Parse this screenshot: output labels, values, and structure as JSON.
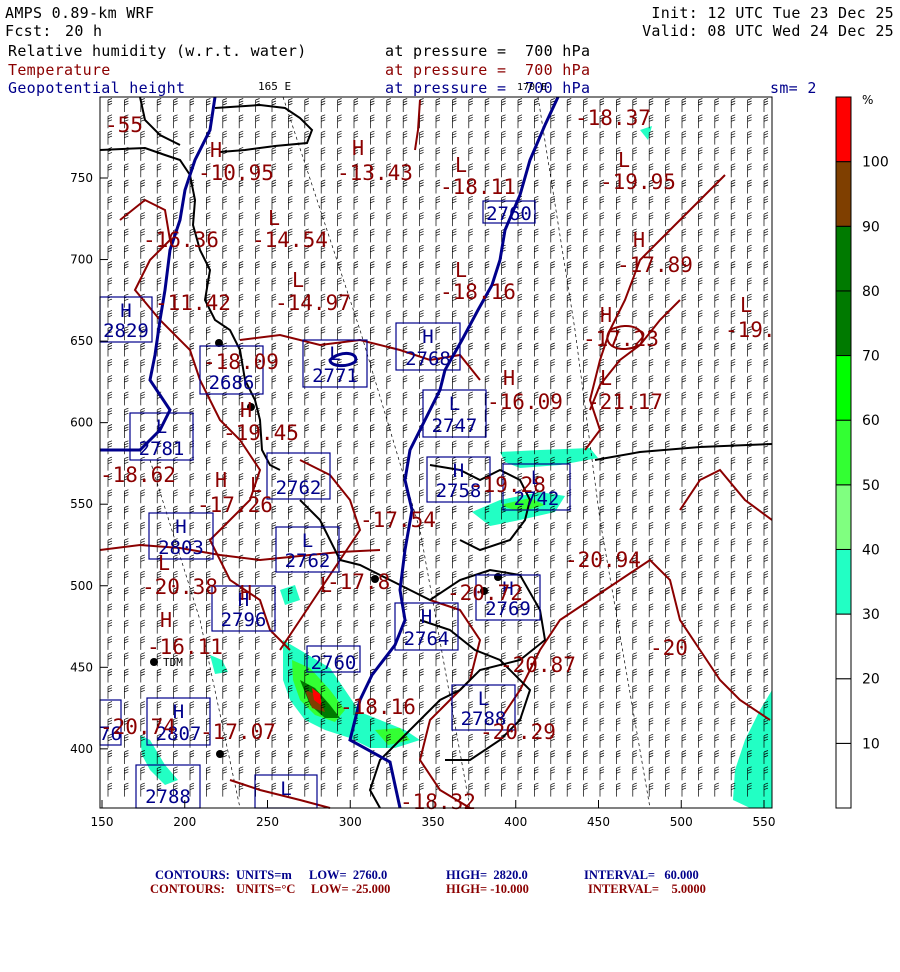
{
  "header": {
    "model": "AMPS 0.89-km WRF",
    "fcst_label": "Fcst:",
    "fcst_value": "20 h",
    "init": "Init: 12 UTC Tue 23 Dec 25",
    "valid": "Valid: 08 UTC Wed 24 Dec 25",
    "sm": "sm= 2"
  },
  "fields": [
    {
      "name": "Relative humidity (w.r.t. water)",
      "level": "at pressure =  700 hPa",
      "color": "#000000"
    },
    {
      "name": "Temperature",
      "level": "at pressure =  700 hPa",
      "color": "#8b0000"
    },
    {
      "name": "Geopotential height",
      "level": "at pressure =  700 hPa",
      "color": "#00008b"
    }
  ],
  "lon_labels": [
    "165 E",
    "170 E"
  ],
  "axes": {
    "x_ticks": [
      "150",
      "200",
      "250",
      "300",
      "350",
      "400",
      "450",
      "500",
      "550"
    ],
    "y_ticks": [
      "750",
      "700",
      "650",
      "600",
      "550",
      "500",
      "450",
      "400"
    ]
  },
  "colorbar": {
    "unit": "%",
    "levels": [
      "10",
      "20",
      "30",
      "40",
      "50",
      "60",
      "70",
      "80",
      "90",
      "100"
    ],
    "colors": [
      "#ffffff",
      "#ffffff",
      "#ffffff",
      "#22ffc4",
      "#80ff80",
      "#33ff33",
      "#00ff00",
      "#007a00",
      "#007a00",
      "#7f3f00",
      "#ff0000"
    ]
  },
  "temperature_labels": [
    "-18.37",
    "-10.95",
    "-13.43",
    "-18.11",
    "-19.95",
    "-14.54",
    "-16.36",
    "-17.89",
    "-18.16",
    "-14.97",
    "-11.42",
    "-17.23",
    "-19.",
    "-18.09",
    "-16.09",
    "-21.17",
    "-19.45",
    "-18.62",
    "-17.26",
    "-17.54",
    "-20.38",
    "-17.8",
    "-20.72",
    "-16.11",
    "-20.94",
    "-20.87",
    "-20",
    "-17.07",
    "-20.74",
    "-18.32",
    "-18.16",
    "-20.29",
    "-19.28",
    "-55"
  ],
  "hl_markers": [
    "H",
    "H",
    "L",
    "L",
    "L",
    "L",
    "H",
    "L",
    "L",
    "H",
    "H",
    "L",
    "H",
    "L",
    "H",
    "H",
    "L",
    "H",
    "L"
  ],
  "height_boxes": [
    {
      "hl": "",
      "value": "2760"
    },
    {
      "hl": "H",
      "value": "2829"
    },
    {
      "hl": "H",
      "value": "2768"
    },
    {
      "hl": "L",
      "value": "2771"
    },
    {
      "hl": "",
      "value": "2686"
    },
    {
      "hl": "L",
      "value": "2747"
    },
    {
      "hl": "L",
      "value": "2781"
    },
    {
      "hl": "",
      "value": "2762"
    },
    {
      "hl": "H",
      "value": "2758"
    },
    {
      "hl": "L",
      "value": "2742"
    },
    {
      "hl": "H",
      "value": "2803"
    },
    {
      "hl": "L",
      "value": "2762"
    },
    {
      "hl": "H",
      "value": "2796"
    },
    {
      "hl": "H",
      "value": "2769"
    },
    {
      "hl": "H",
      "value": "2764"
    },
    {
      "hl": "",
      "value": "2760"
    },
    {
      "hl": "L",
      "value": "2788"
    },
    {
      "hl": "H",
      "value": "2807"
    },
    {
      "hl": "",
      "value": "76"
    },
    {
      "hl": "",
      "value": "2788"
    },
    {
      "hl": "L",
      "value": ""
    }
  ],
  "station": "TDM",
  "footer": {
    "height_line": {
      "contours": "CONTOURS:",
      "units": "UNITS=m",
      "low": "LOW=  2760.0",
      "high": "HIGH=  2820.0",
      "interval": "INTERVAL=   60.000",
      "color": "#00008b"
    },
    "temp_line": {
      "contours": "CONTOURS:",
      "units": "UNITS=°C",
      "low": "LOW= -25.000",
      "high": "HIGH= -10.000",
      "interval": "INTERVAL=    5.0000",
      "color": "#8b0000"
    }
  }
}
